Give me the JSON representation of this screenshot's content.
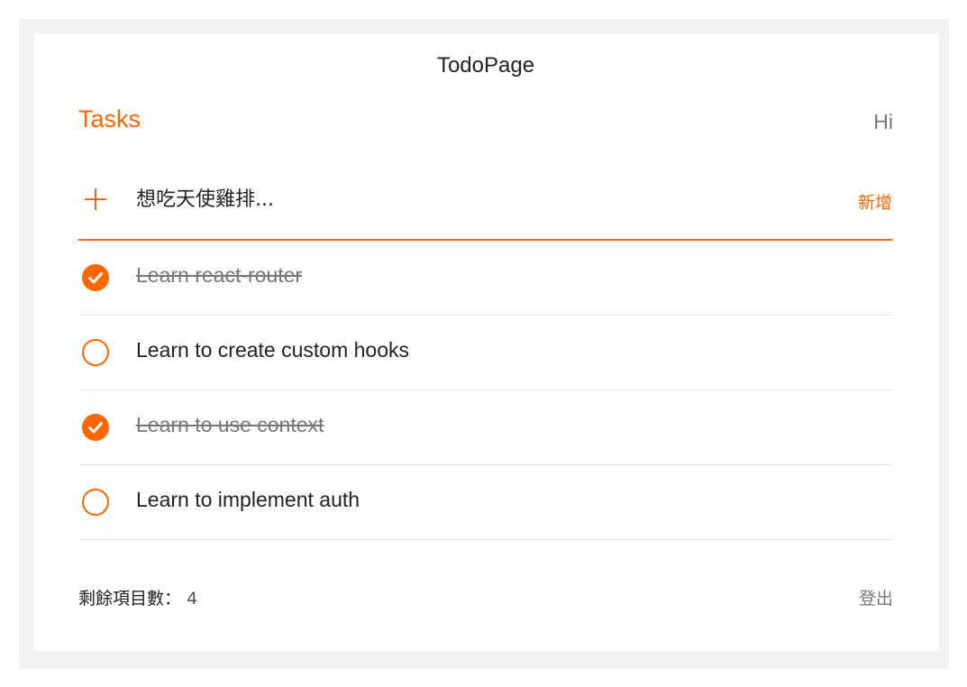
{
  "header": {
    "title": "TodoPage"
  },
  "tasks": {
    "heading": "Tasks",
    "greeting": "Hi"
  },
  "add_row": {
    "icon": "plus-icon",
    "input_value": "",
    "input_placeholder": "想吃天使雞排...",
    "add_label": "新增"
  },
  "todos": [
    {
      "text": "Learn react-router",
      "completed": true
    },
    {
      "text": "Learn to create custom hooks",
      "completed": false
    },
    {
      "text": "Learn to use context",
      "completed": true
    },
    {
      "text": "Learn to implement auth",
      "completed": false
    }
  ],
  "footer": {
    "remaining_label": "剩餘項目數：",
    "remaining_count": "4",
    "logout_label": "登出"
  },
  "colors": {
    "accent": "#ff6600",
    "frame_background": "#f2f2f2",
    "card_background": "#ffffff",
    "divider": "#e6e6e6",
    "muted_text": "#777777"
  }
}
